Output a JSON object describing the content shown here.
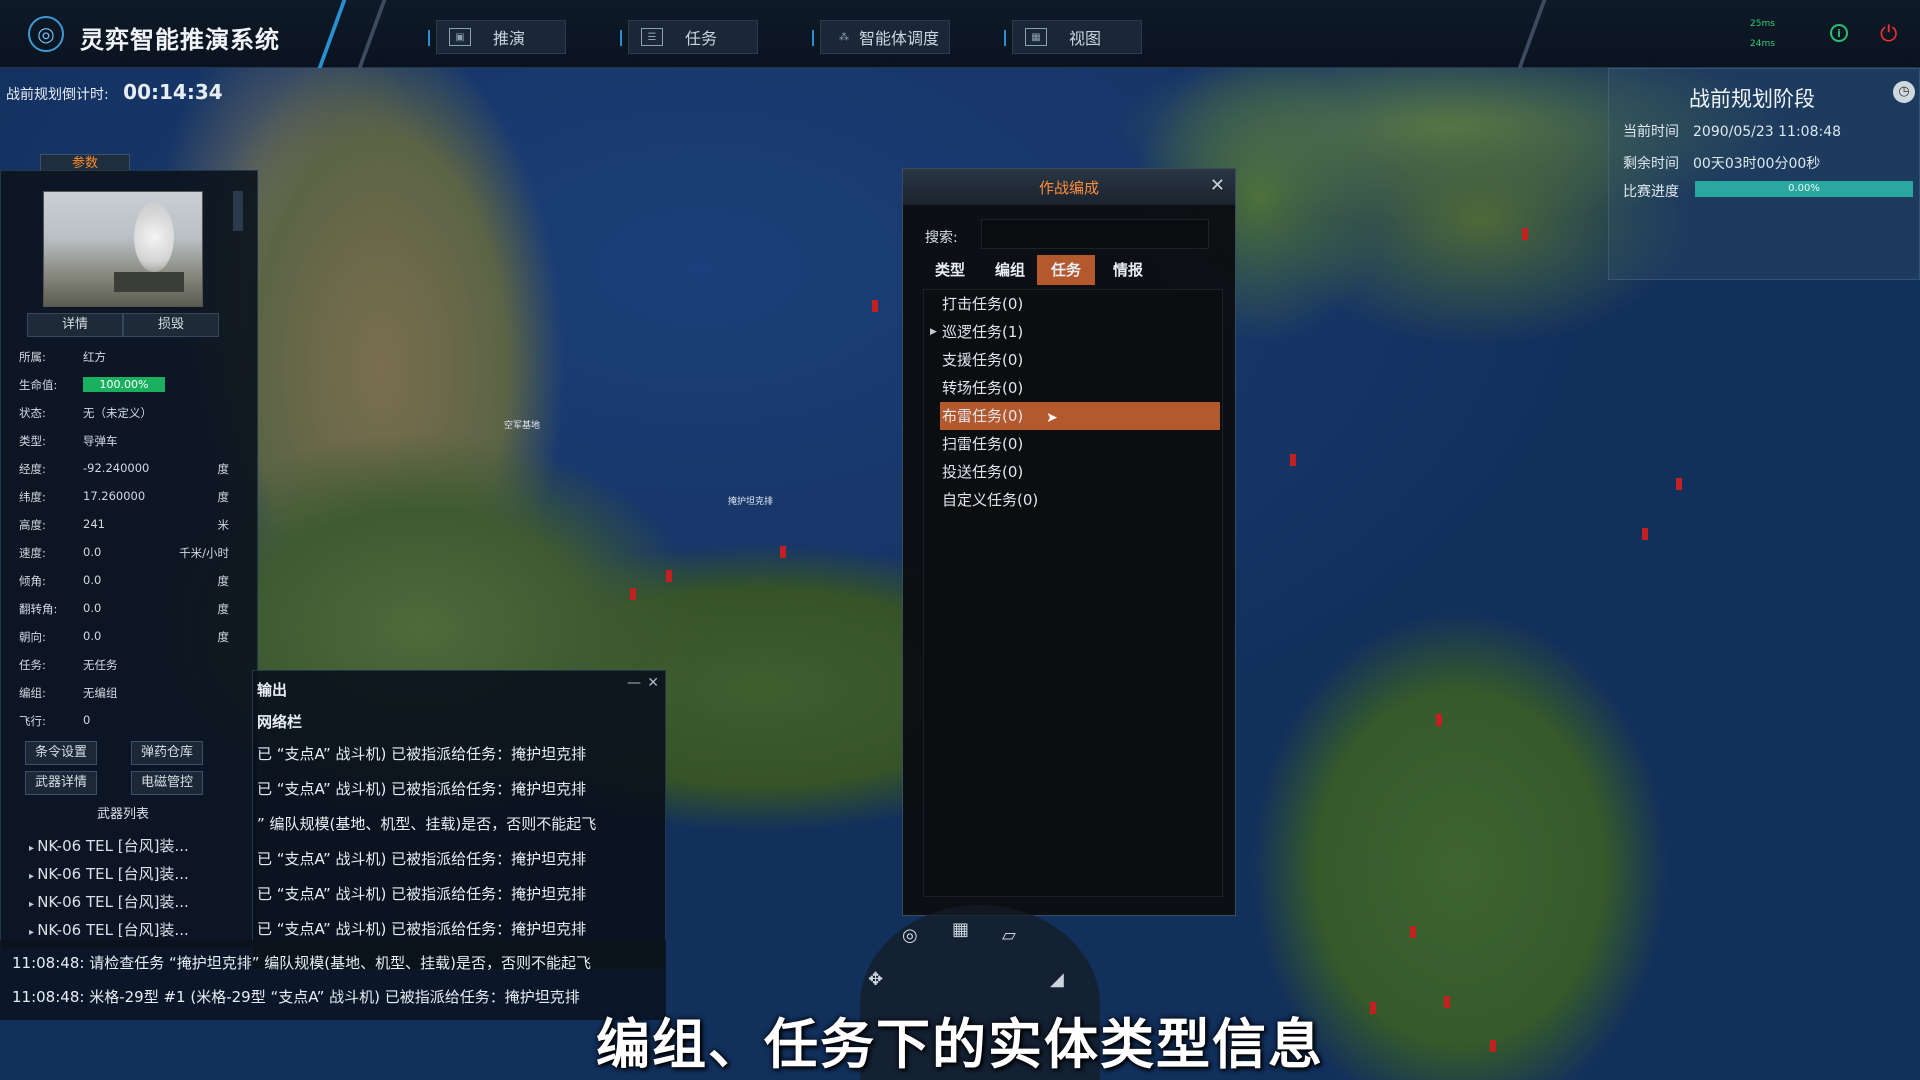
{
  "app": {
    "title": "灵弈智能推演系统"
  },
  "nav": [
    {
      "label": "推演",
      "icon": "film-icon"
    },
    {
      "label": "任务",
      "icon": "list-icon"
    },
    {
      "label": "智能体调度",
      "icon": "network-icon"
    },
    {
      "label": "视图",
      "icon": "image-icon"
    }
  ],
  "latency": {
    "a": "25ms",
    "b": "24ms"
  },
  "countdown": {
    "label": "战前规划倒计时:",
    "value": "00:14:34"
  },
  "params": {
    "tab": "参数",
    "buttons": {
      "detail": "详情",
      "destroy": "损毁"
    },
    "rows": [
      {
        "k": "所属:",
        "v": "红方",
        "u": ""
      },
      {
        "k": "生命值:",
        "v": "100.00%",
        "u": ""
      },
      {
        "k": "状态:",
        "v": "无（未定义）",
        "u": ""
      },
      {
        "k": "类型:",
        "v": "导弹车",
        "u": ""
      },
      {
        "k": "经度:",
        "v": "-92.240000",
        "u": "度"
      },
      {
        "k": "纬度:",
        "v": "17.260000",
        "u": "度"
      },
      {
        "k": "高度:",
        "v": "241",
        "u": "米"
      },
      {
        "k": "速度:",
        "v": "0.0",
        "u": "千米/小时"
      },
      {
        "k": "倾角:",
        "v": "0.0",
        "u": "度"
      },
      {
        "k": "翻转角:",
        "v": "0.0",
        "u": "度"
      },
      {
        "k": "朝向:",
        "v": "0.0",
        "u": "度"
      },
      {
        "k": "任务:",
        "v": "无任务",
        "u": ""
      },
      {
        "k": "编组:",
        "v": "无编组",
        "u": ""
      },
      {
        "k": "飞行:",
        "v": "0",
        "u": ""
      }
    ],
    "actions": {
      "orders": "条令设置",
      "ammo": "弹药仓库",
      "weapons": "武器详情",
      "emcon": "电磁管控"
    },
    "weapons_title": "武器列表",
    "weapons": [
      "NK-06 TEL [台风]装...",
      "NK-06 TEL [台风]装...",
      "NK-06 TEL [台风]装...",
      "NK-06 TEL [台风]装..."
    ]
  },
  "output": {
    "title": "输出",
    "sub": "网络栏",
    "lines": [
      "已 “支点A” 战斗机) 已被指派给任务：掩护坦克排",
      "已 “支点A” 战斗机) 已被指派给任务：掩护坦克排",
      "” 编队规模(基地、机型、挂载)是否，否则不能起飞",
      "已 “支点A” 战斗机) 已被指派给任务：掩护坦克排",
      "已 “支点A” 战斗机) 已被指派给任务：掩护坦克排",
      "已 “支点A” 战斗机) 已被指派给任务：掩护坦克排"
    ],
    "long_lines": [
      "11:08:48: 请检查任务 “掩护坦克排” 编队规模(基地、机型、挂载)是否，否则不能起飞",
      "11:08:48: 米格-29型 #1 (米格-29型 “支点A” 战斗机) 已被指派给任务：掩护坦克排"
    ]
  },
  "dialog": {
    "title": "作战编成",
    "search_label": "搜索:",
    "search_value": "",
    "tabs": [
      "类型",
      "编组",
      "任务",
      "情报"
    ],
    "active_tab": "任务",
    "tasks": [
      "打击任务(0)",
      "巡逻任务(1)",
      "支援任务(0)",
      "转场任务(0)",
      "布雷任务(0)",
      "扫雷任务(0)",
      "投送任务(0)",
      "自定义任务(0)"
    ],
    "selected_task": "布雷任务(0)"
  },
  "phase": {
    "title": "战前规划阶段",
    "current_label": "当前时间",
    "current_value": "2090/05/23 11:08:48",
    "remain_label": "剩余时间",
    "remain_value": "00天03时00分00秒",
    "progress_label": "比赛进度",
    "progress_value": "0.00%"
  },
  "map_labels": {
    "base": "空军基地",
    "group": "掩护坦克排"
  },
  "subtitle": "编组、任务下的实体类型信息",
  "colors": {
    "accent": "#b4582e",
    "title_orange": "#ff8c3a",
    "health": "#19b060",
    "progress": "#2aa8a0"
  }
}
